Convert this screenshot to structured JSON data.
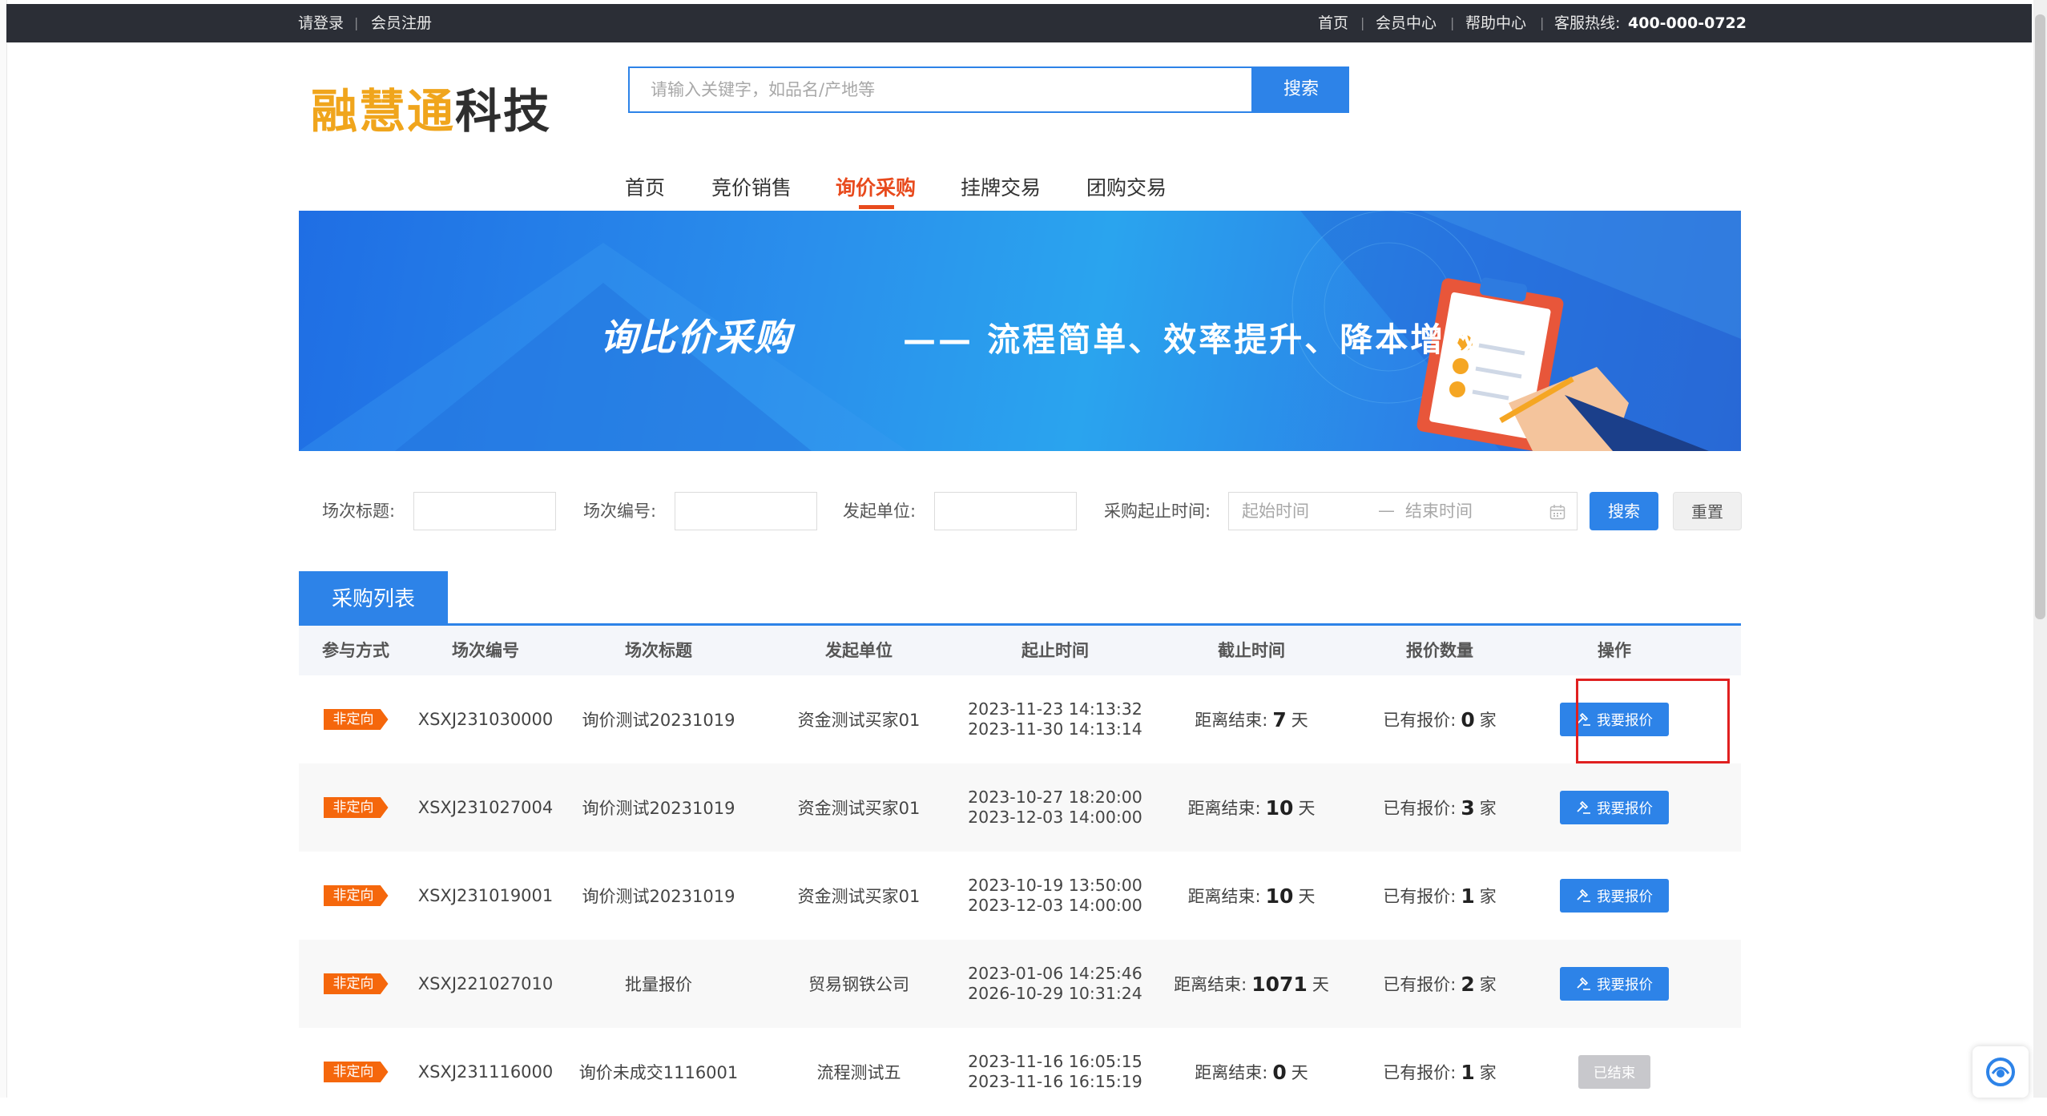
{
  "topbar": {
    "login": "请登录",
    "register": "会员注册",
    "home": "首页",
    "member_center": "会员中心",
    "help_center": "帮助中心",
    "hotline_label": "客服热线:",
    "hotline": "400-000-0722"
  },
  "logo": {
    "part1": "融慧通",
    "part2": "科技"
  },
  "search": {
    "placeholder": "请输入关键字，如品名/产地等",
    "button": "搜索"
  },
  "nav": [
    "首页",
    "竞价销售",
    "询价采购",
    "挂牌交易",
    "团购交易"
  ],
  "nav_active": "询价采购",
  "banner": {
    "title": "询比价采购",
    "subtitle": "—— 流程简单、效率提升、降本增效"
  },
  "filters": {
    "title_label": "场次标题:",
    "code_label": "场次编号:",
    "org_label": "发起单位:",
    "time_label": "采购起止时间:",
    "start_placeholder": "起始时间",
    "end_placeholder": "结束时间",
    "search_button": "搜索",
    "reset_button": "重置"
  },
  "list_tab": "采购列表",
  "table": {
    "headers": [
      "参与方式",
      "场次编号",
      "场次标题",
      "发起单位",
      "起止时间",
      "截止时间",
      "报价数量",
      "操作"
    ],
    "rows": [
      {
        "mode": "非定向",
        "code": "XSXJ231030000",
        "title": "询价测试20231019",
        "org": "资金测试买家01",
        "start": "2023-11-23 14:13:32",
        "end": "2023-11-30 14:13:14",
        "remain_prefix": "距离结束:",
        "remain_days": "7",
        "remain_unit": "天",
        "quote_prefix": "已有报价:",
        "quote_count": "0",
        "quote_unit": "家",
        "action": "我要报价",
        "action_type": "quote"
      },
      {
        "mode": "非定向",
        "code": "XSXJ231027004",
        "title": "询价测试20231019",
        "org": "资金测试买家01",
        "start": "2023-10-27 18:20:00",
        "end": "2023-12-03 14:00:00",
        "remain_prefix": "距离结束:",
        "remain_days": "10",
        "remain_unit": "天",
        "quote_prefix": "已有报价:",
        "quote_count": "3",
        "quote_unit": "家",
        "action": "我要报价",
        "action_type": "quote"
      },
      {
        "mode": "非定向",
        "code": "XSXJ231019001",
        "title": "询价测试20231019",
        "org": "资金测试买家01",
        "start": "2023-10-19 13:50:00",
        "end": "2023-12-03 14:00:00",
        "remain_prefix": "距离结束:",
        "remain_days": "10",
        "remain_unit": "天",
        "quote_prefix": "已有报价:",
        "quote_count": "1",
        "quote_unit": "家",
        "action": "我要报价",
        "action_type": "quote"
      },
      {
        "mode": "非定向",
        "code": "XSXJ221027010",
        "title": "批量报价",
        "org": "贸易钢铁公司",
        "start": "2023-01-06 14:25:46",
        "end": "2026-10-29 10:31:24",
        "remain_prefix": "距离结束:",
        "remain_days": "1071",
        "remain_unit": "天",
        "quote_prefix": "已有报价:",
        "quote_count": "2",
        "quote_unit": "家",
        "action": "我要报价",
        "action_type": "quote"
      },
      {
        "mode": "非定向",
        "code": "XSXJ231116000",
        "title": "询价未成交1116001",
        "org": "流程测试五",
        "start": "2023-11-16 16:05:15",
        "end": "2023-11-16 16:15:19",
        "remain_prefix": "距离结束:",
        "remain_days": "0",
        "remain_unit": "天",
        "quote_prefix": "已有报价:",
        "quote_count": "1",
        "quote_unit": "家",
        "action": "已结束",
        "action_type": "ended"
      }
    ]
  },
  "colors": {
    "primary": "#2d83e8",
    "accent": "#e84a1d",
    "tag": "#f5670c",
    "topbar": "#2b2e36",
    "logo_gold": "#f0a51c"
  },
  "icons": {
    "quote_button": "gavel-icon",
    "date_range": "calendar-icon",
    "float_widget": "support-icon"
  }
}
